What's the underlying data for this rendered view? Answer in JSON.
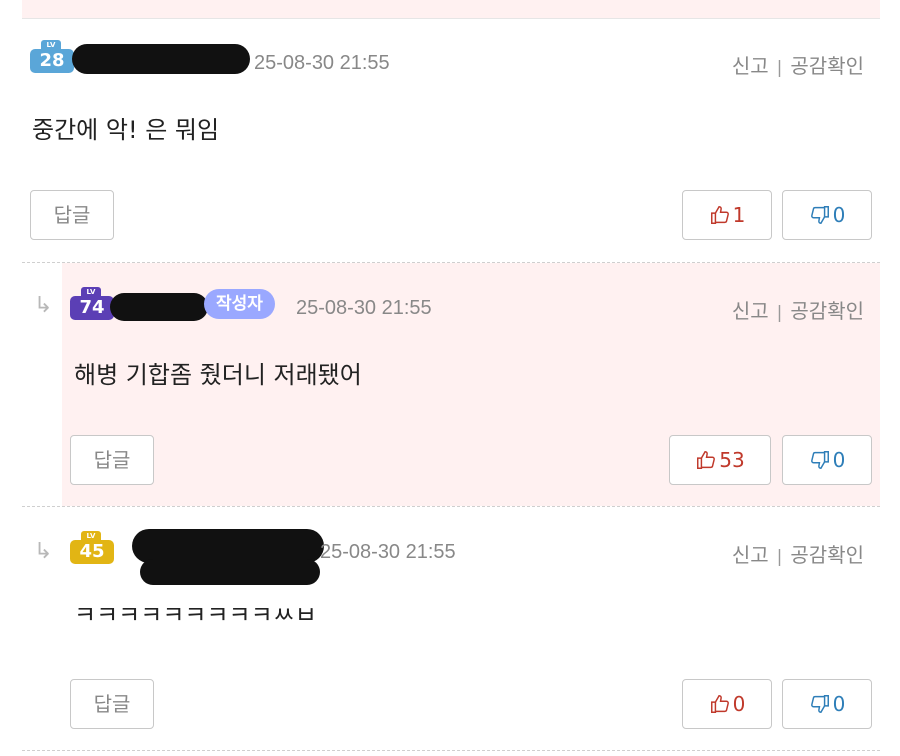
{
  "comments": [
    {
      "level": "28",
      "date": "25-08-30 21:55",
      "report": "신고",
      "sympathy": "공감확인",
      "text": "중간에 악! 은 뭐임",
      "reply_label": "답글",
      "likes": "1",
      "dislikes": "0"
    },
    {
      "level": "74",
      "author_badge": "작성자",
      "date": "25-08-30 21:55",
      "report": "신고",
      "sympathy": "공감확인",
      "text": "해병 기합좀 줬더니 저래됐어",
      "reply_label": "답글",
      "likes": "53",
      "dislikes": "0"
    },
    {
      "level": "45",
      "date": "25-08-30 21:55",
      "report": "신고",
      "sympathy": "공감확인",
      "text": "ㅋㅋㅋㅋㅋㅋㅋㅋㅋㅆㅂ",
      "reply_label": "답글",
      "likes": "0",
      "dislikes": "0"
    }
  ],
  "lv_prefix": "LV",
  "colors": {
    "level_28": "#5aa6d8",
    "level_74": "#5b3fb5",
    "level_45": "#e2b514",
    "author_badge": "#9aa8ff",
    "reply_background": "#fff1f1",
    "like": "#c0392b",
    "dislike": "#2e7eb8"
  },
  "icons": [
    "reply-arrow-icon",
    "thumbs-up-icon",
    "thumbs-down-icon",
    "level-badge-icon"
  ]
}
